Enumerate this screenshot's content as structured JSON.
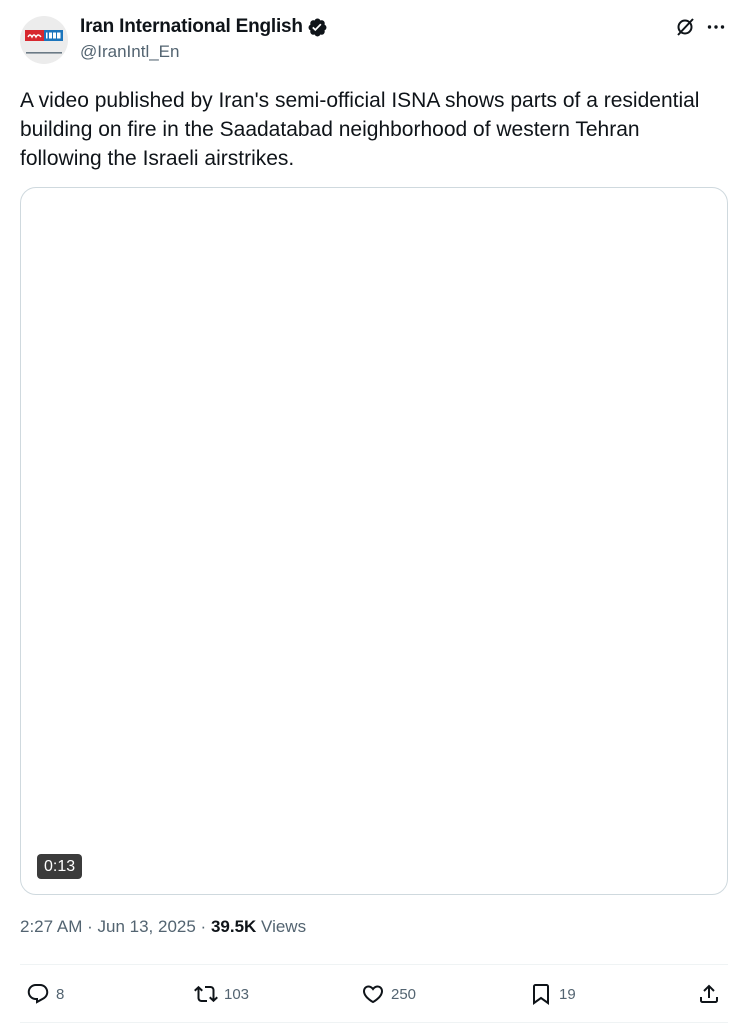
{
  "author": {
    "display_name": "Iran International English",
    "handle": "@IranIntl_En",
    "verified": true,
    "avatar_logo_text": "IRAN",
    "avatar_logo_sub": "INTERNATIONAL"
  },
  "tweet": {
    "text": "A video published by Iran's semi-official ISNA shows parts of a residential building on fire in the Saadatabad neighborhood of western Tehran following the Israeli airstrikes."
  },
  "media": {
    "type": "video",
    "duration": "0:13"
  },
  "meta": {
    "time": "2:27 AM",
    "separator": "·",
    "date": "Jun 13, 2025",
    "views_count": "39.5K",
    "views_label": "Views"
  },
  "actions": {
    "replies": "8",
    "reposts": "103",
    "likes": "250",
    "bookmarks": "19"
  },
  "icons": {
    "top_right": [
      "grok-icon",
      "more-icon"
    ],
    "actions": [
      "reply-icon",
      "repost-icon",
      "like-icon",
      "bookmark-icon",
      "share-icon"
    ]
  },
  "colors": {
    "text_primary": "#0f1419",
    "text_secondary": "#536471",
    "border": "#cfd9de",
    "divider": "#eff3f4",
    "logo_red": "#d7282f",
    "logo_blue": "#1c75bc"
  }
}
